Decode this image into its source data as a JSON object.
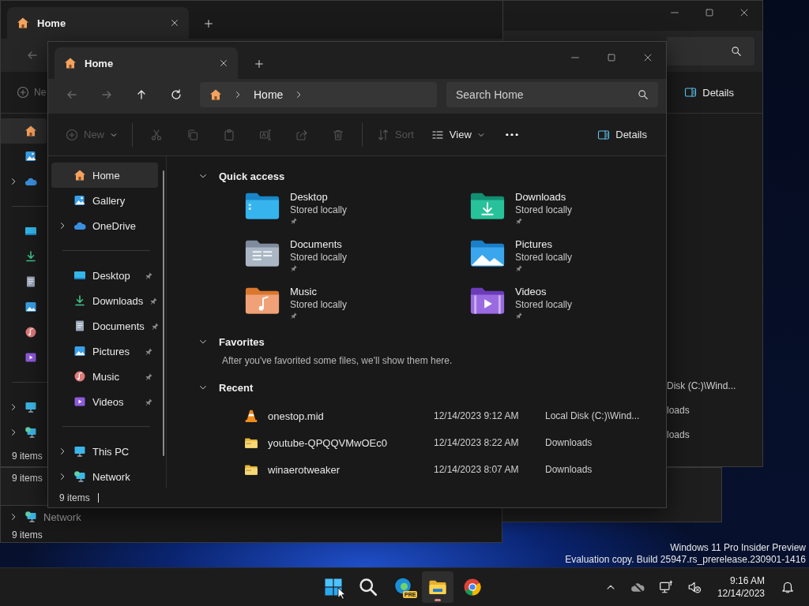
{
  "back_windows": [
    {
      "kind": "tabbed",
      "tab_title": "Home",
      "new_label": "Ne",
      "sidebar": [
        [
          {
            "kind": "home",
            "selected": true,
            "expandable": false
          },
          {
            "kind": "gallery",
            "selected": false,
            "expandable": false
          },
          {
            "kind": "onedrive",
            "selected": false,
            "expandable": true
          }
        ],
        [
          {
            "kind": "desktop",
            "selected": false,
            "expandable": false
          },
          {
            "kind": "downloads",
            "selected": false,
            "expandable": false
          },
          {
            "kind": "documents",
            "selected": false,
            "expandable": false
          },
          {
            "kind": "pictures",
            "selected": false,
            "expandable": false
          },
          {
            "kind": "music",
            "selected": false,
            "expandable": false
          },
          {
            "kind": "videos",
            "selected": false,
            "expandable": false
          }
        ],
        [
          {
            "kind": "thispc",
            "selected": false,
            "expandable": true
          },
          {
            "kind": "network",
            "selected": false,
            "expandable": true
          }
        ]
      ],
      "status": "9 items"
    },
    {
      "kind": "wide",
      "details_label": "Details",
      "rows": [
        "Disk (C:)\\Wind...",
        "loads",
        "loads"
      ]
    },
    {
      "kind": "strip_mid",
      "status": "9 items"
    },
    {
      "kind": "strip_low",
      "sidebar": [
        {
          "label": "Network",
          "kind": "network",
          "expandable": true
        }
      ],
      "status": "9 items"
    }
  ],
  "window": {
    "tab_title": "Home",
    "nav": [
      {
        "kind": "back",
        "disabled": true
      },
      {
        "kind": "forward",
        "disabled": true
      },
      {
        "kind": "up",
        "disabled": false
      },
      {
        "kind": "refresh",
        "disabled": false
      }
    ],
    "breadcrumb": [
      "Home"
    ],
    "search": {
      "placeholder": "Search Home"
    },
    "commands": [
      {
        "kind": "new",
        "label": "New",
        "disabled": true
      },
      {
        "kind": "cut",
        "disabled": true
      },
      {
        "kind": "copy",
        "disabled": true
      },
      {
        "kind": "paste",
        "disabled": true
      },
      {
        "kind": "rename",
        "disabled": true
      },
      {
        "kind": "share",
        "disabled": true
      },
      {
        "kind": "delete",
        "disabled": true
      },
      {
        "kind": "sort",
        "label": "Sort",
        "disabled": true
      },
      {
        "kind": "view",
        "label": "View",
        "disabled": false
      },
      {
        "kind": "more",
        "disabled": false
      }
    ],
    "details_label": "Details",
    "sidebar": [
      [
        {
          "label": "Home",
          "kind": "home",
          "selected": true,
          "expandable": false,
          "pinned": false
        },
        {
          "label": "Gallery",
          "kind": "gallery",
          "selected": false,
          "expandable": false,
          "pinned": false
        },
        {
          "label": "OneDrive",
          "kind": "onedrive",
          "selected": false,
          "expandable": true,
          "pinned": false
        }
      ],
      [
        {
          "label": "Desktop",
          "kind": "desktop",
          "selected": false,
          "expandable": false,
          "pinned": true
        },
        {
          "label": "Downloads",
          "kind": "downloads",
          "selected": false,
          "expandable": false,
          "pinned": true
        },
        {
          "label": "Documents",
          "kind": "documents",
          "selected": false,
          "expandable": false,
          "pinned": true
        },
        {
          "label": "Pictures",
          "kind": "pictures",
          "selected": false,
          "expandable": false,
          "pinned": true
        },
        {
          "label": "Music",
          "kind": "music",
          "selected": false,
          "expandable": false,
          "pinned": true
        },
        {
          "label": "Videos",
          "kind": "videos",
          "selected": false,
          "expandable": false,
          "pinned": true
        }
      ],
      [
        {
          "label": "This PC",
          "kind": "thispc",
          "selected": false,
          "expandable": true,
          "pinned": false
        },
        {
          "label": "Network",
          "kind": "network",
          "selected": false,
          "expandable": true,
          "pinned": false
        }
      ]
    ],
    "sections": [
      {
        "kind": "quick_access",
        "title": "Quick access",
        "expanded": true,
        "folders": [
          {
            "name": "Desktop",
            "kind": "desktop",
            "status": "Stored locally",
            "pinned": true
          },
          {
            "name": "Downloads",
            "kind": "downloads",
            "status": "Stored locally",
            "pinned": true
          },
          {
            "name": "Documents",
            "kind": "documents",
            "status": "Stored locally",
            "pinned": true
          },
          {
            "name": "Pictures",
            "kind": "pictures",
            "status": "Stored locally",
            "pinned": true
          },
          {
            "name": "Music",
            "kind": "music",
            "status": "Stored locally",
            "pinned": true
          },
          {
            "name": "Videos",
            "kind": "videos",
            "status": "Stored locally",
            "pinned": true
          }
        ]
      },
      {
        "kind": "favorites",
        "title": "Favorites",
        "expanded": true,
        "message": "After you've favorited some files, we'll show them here."
      },
      {
        "kind": "recent",
        "title": "Recent",
        "expanded": true,
        "files": [
          {
            "name": "onestop.mid",
            "kind": "cone",
            "date": "12/14/2023 9:12 AM",
            "location": "Local Disk (C:)\\Wind..."
          },
          {
            "name": "youtube-QPQQVMwOEc0",
            "kind": "zip",
            "date": "12/14/2023 8:22 AM",
            "location": "Downloads"
          },
          {
            "name": "winaerotweaker",
            "kind": "zip",
            "date": "12/14/2023 8:07 AM",
            "location": "Downloads"
          }
        ]
      }
    ],
    "status": "9 items"
  },
  "desktop": {
    "info_lines": [
      "Windows 11 Pro Insider Preview",
      "Evaluation copy. Build 25947.rs_prerelease.230901-1416"
    ]
  },
  "taskbar": {
    "apps": [
      {
        "kind": "start",
        "active": false
      },
      {
        "kind": "search",
        "active": false
      },
      {
        "kind": "browser_pre",
        "badge": "PRE",
        "active": false
      },
      {
        "kind": "explorer",
        "active": true
      },
      {
        "kind": "browser",
        "active": false
      }
    ],
    "time": "9:16 AM",
    "date": "12/14/2023"
  }
}
